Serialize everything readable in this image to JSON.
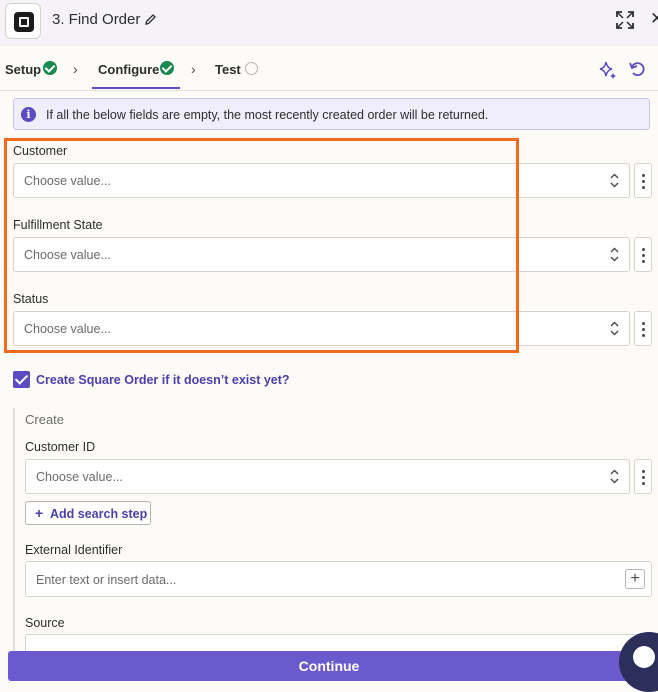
{
  "header": {
    "title": "3. Find Order"
  },
  "tabs": [
    {
      "label": "Setup",
      "status": "complete"
    },
    {
      "label": "Configure",
      "status": "complete",
      "active": true
    },
    {
      "label": "Test",
      "status": "pending"
    }
  ],
  "info": {
    "text": "If all the below fields are empty, the most recently created order will be returned."
  },
  "fields": [
    {
      "label": "Customer",
      "placeholder": "Choose value..."
    },
    {
      "label": "Fulfillment State",
      "placeholder": "Choose value..."
    },
    {
      "label": "Status",
      "placeholder": "Choose value..."
    }
  ],
  "create_option": {
    "label": "Create Square Order if it doesn’t exist yet?",
    "checked": true
  },
  "create_section": {
    "title": "Create",
    "customer_id": {
      "label": "Customer ID",
      "placeholder": "Choose value..."
    },
    "add_search_step": "Add search step",
    "external_identifier": {
      "label": "External Identifier",
      "placeholder": "Enter text or insert data..."
    },
    "source": {
      "label": "Source"
    }
  },
  "footer": {
    "continue_label": "Continue"
  },
  "colors": {
    "accent": "#5b4cc4",
    "success": "#188a4f",
    "highlight": "#f26b1d"
  }
}
